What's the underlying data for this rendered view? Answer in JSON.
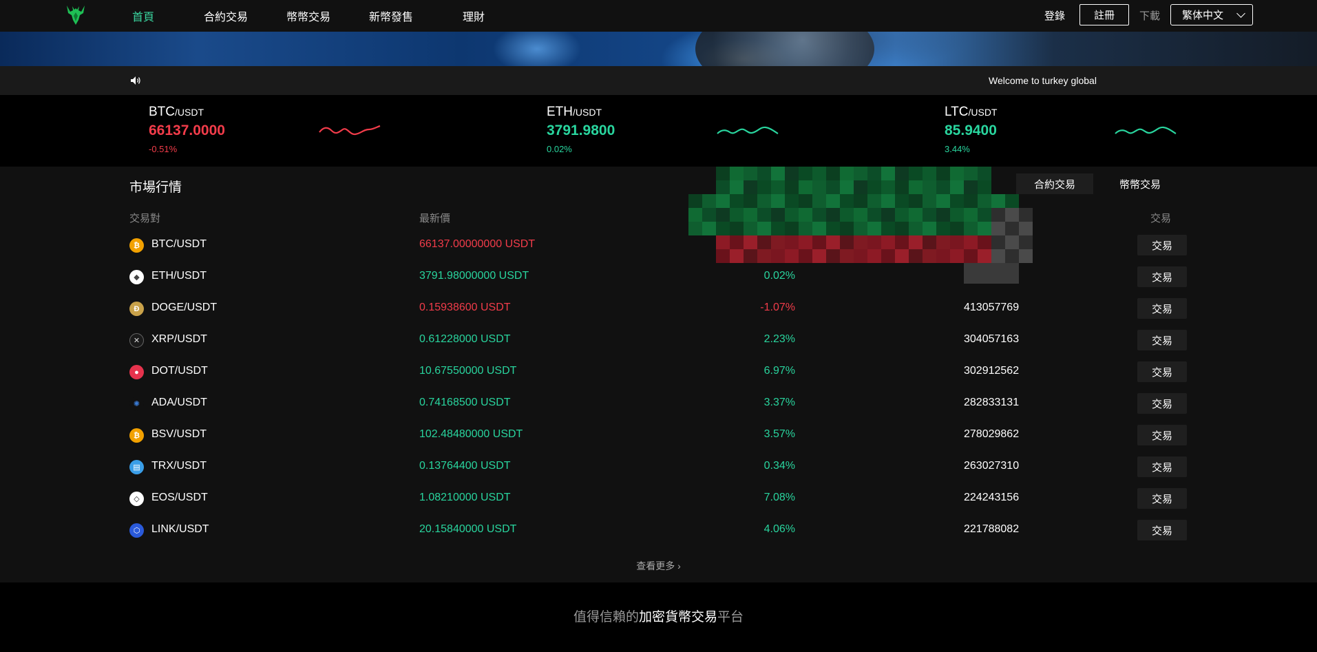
{
  "nav": {
    "items": [
      "首頁",
      "合約交易",
      "幣幣交易",
      "新幣發售",
      "理財"
    ],
    "login": "登錄",
    "register": "註冊",
    "download": "下載",
    "language": "繁体中文"
  },
  "announce": {
    "text": "Welcome to turkey global"
  },
  "ticker": [
    {
      "base": "BTC",
      "quote": "/USDT",
      "price": "66137.0000",
      "change": "-0.51%",
      "trend": "down"
    },
    {
      "base": "ETH",
      "quote": "/USDT",
      "price": "3791.9800",
      "change": "0.02%",
      "trend": "up"
    },
    {
      "base": "LTC",
      "quote": "/USDT",
      "price": "85.9400",
      "change": "3.44%",
      "trend": "up"
    }
  ],
  "market": {
    "title": "市場行情",
    "tabs": [
      "合約交易",
      "幣幣交易"
    ],
    "columns": {
      "pair": "交易對",
      "price": "最新價",
      "action": "交易"
    },
    "trade_label": "交易",
    "see_more": "查看更多 ›",
    "rows": [
      {
        "pair": "BTC/USDT",
        "price": "66137.00000000 USDT",
        "change": "",
        "volume": "",
        "trend": "down",
        "icon": "btc-icon"
      },
      {
        "pair": "ETH/USDT",
        "price": "3791.98000000 USDT",
        "change": "0.02%",
        "volume": "",
        "trend": "up",
        "icon": "eth-icon"
      },
      {
        "pair": "DOGE/USDT",
        "price": "0.15938600 USDT",
        "change": "-1.07%",
        "volume": "413057769",
        "trend": "down",
        "icon": "doge-icon"
      },
      {
        "pair": "XRP/USDT",
        "price": "0.61228000 USDT",
        "change": "2.23%",
        "volume": "304057163",
        "trend": "up",
        "icon": "xrp-icon"
      },
      {
        "pair": "DOT/USDT",
        "price": "10.67550000 USDT",
        "change": "6.97%",
        "volume": "302912562",
        "trend": "up",
        "icon": "dot-icon"
      },
      {
        "pair": "ADA/USDT",
        "price": "0.74168500 USDT",
        "change": "3.37%",
        "volume": "282833131",
        "trend": "up",
        "icon": "ada-icon"
      },
      {
        "pair": "BSV/USDT",
        "price": "102.48480000 USDT",
        "change": "3.57%",
        "volume": "278029862",
        "trend": "up",
        "icon": "bsv-icon"
      },
      {
        "pair": "TRX/USDT",
        "price": "0.13764400 USDT",
        "change": "0.34%",
        "volume": "263027310",
        "trend": "up",
        "icon": "trx-icon"
      },
      {
        "pair": "EOS/USDT",
        "price": "1.08210000 USDT",
        "change": "7.08%",
        "volume": "224243156",
        "trend": "up",
        "icon": "eos-icon"
      },
      {
        "pair": "LINK/USDT",
        "price": "20.15840000 USDT",
        "change": "4.06%",
        "volume": "221788082",
        "trend": "up",
        "icon": "link-icon"
      }
    ]
  },
  "footer": {
    "slogan_pre": "值得信賴的",
    "slogan_hl": "加密貨幣交易",
    "slogan_post": "平台"
  },
  "colors": {
    "accent": "#3ad6a0",
    "up": "#29d59e",
    "down": "#f23c4a",
    "background": "#111111"
  }
}
